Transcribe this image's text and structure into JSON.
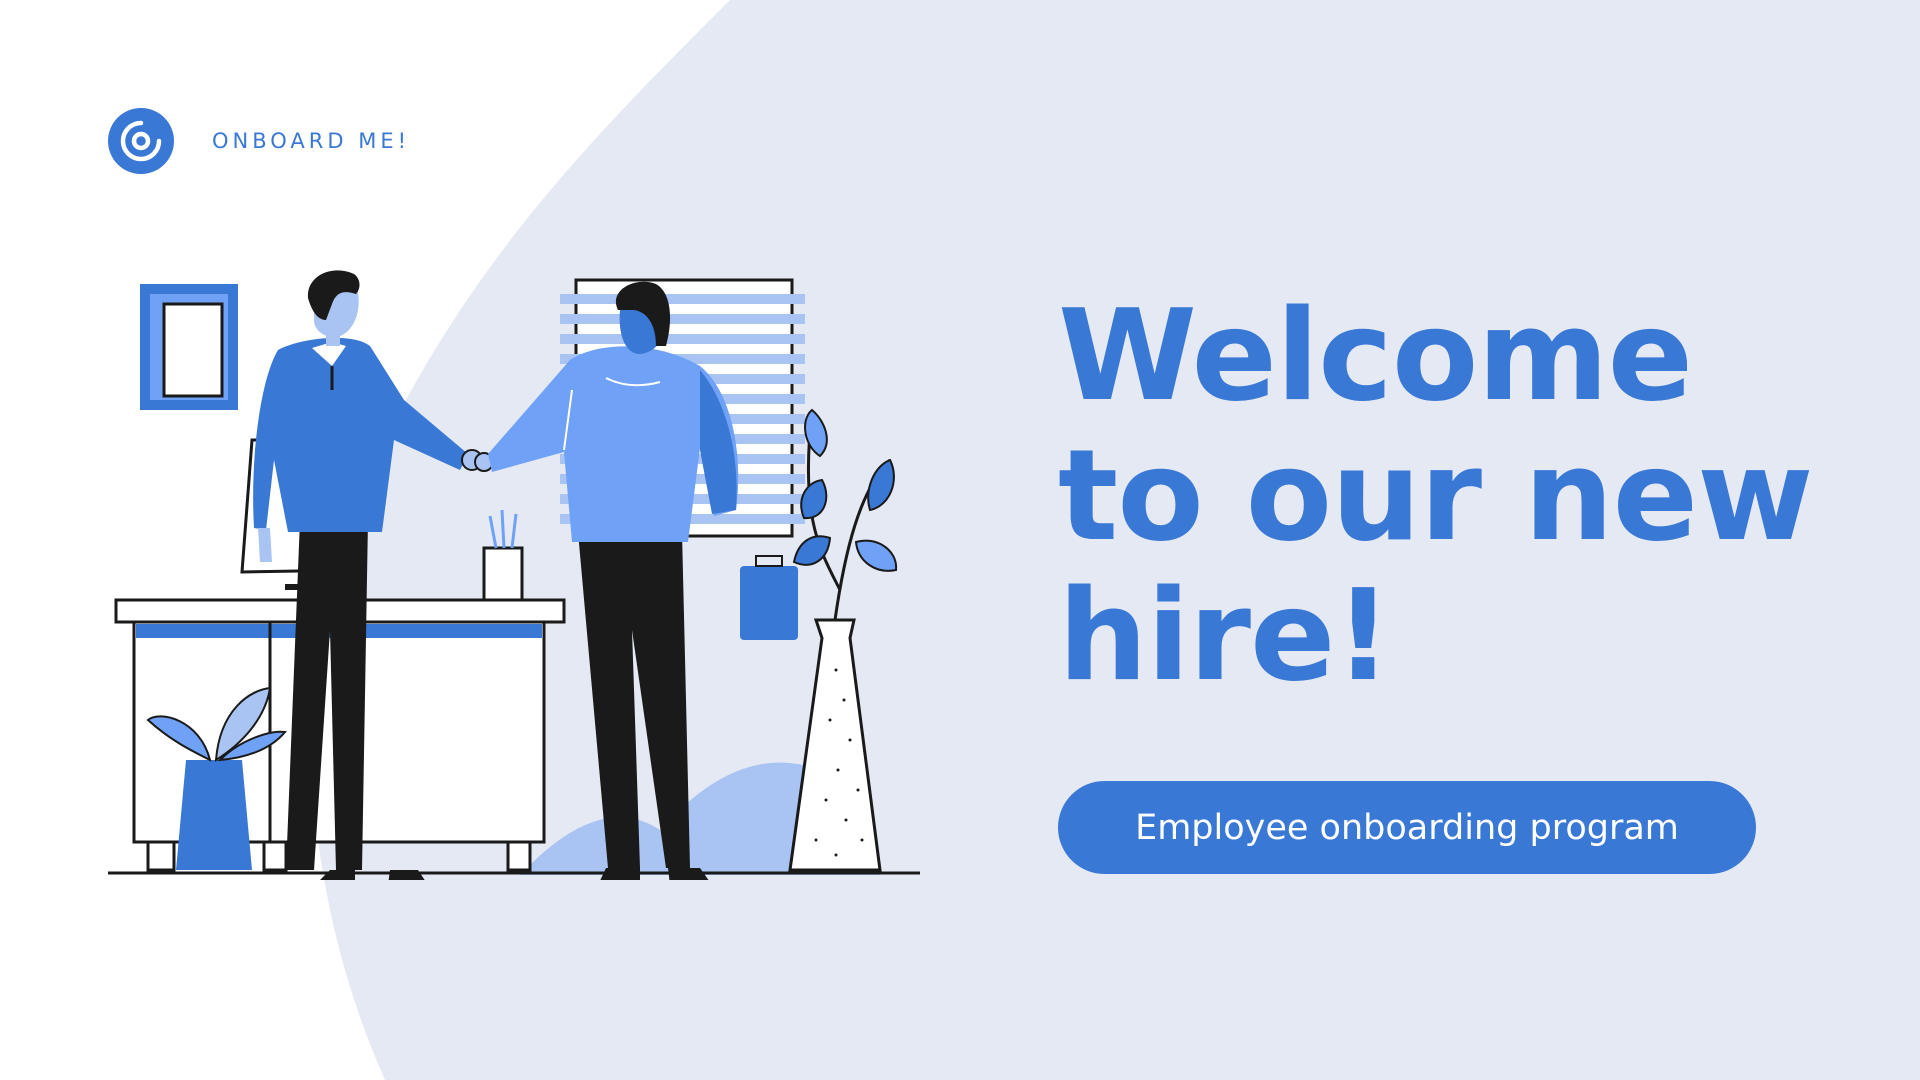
{
  "brand": {
    "name": "ONBOARD ME!",
    "logo_icon": "concentric-circle-logo-icon"
  },
  "headline": "Welcome to our new hire!",
  "cta": {
    "label": "Employee onboarding program"
  },
  "illustration": {
    "subject": "handshake-office-scene-icon"
  },
  "colors": {
    "accent": "#3a78d6",
    "light_blue": "#6fa2f7",
    "pale_blue": "#a9c4f2",
    "background_shape": "#e4e9f4",
    "ink": "#1a1a1a",
    "white": "#ffffff"
  }
}
